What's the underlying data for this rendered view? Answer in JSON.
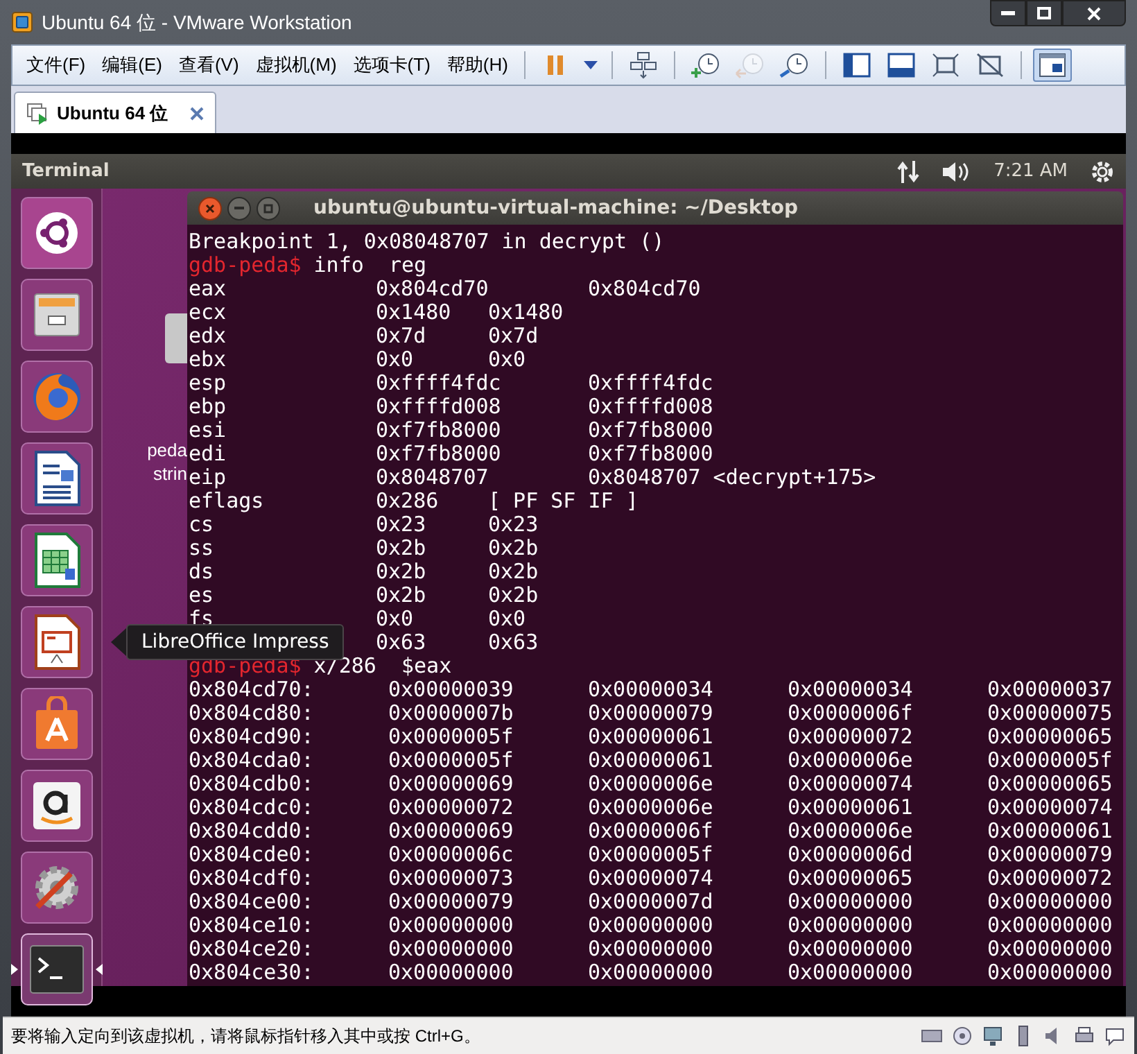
{
  "window": {
    "title": "Ubuntu 64 位 - VMware Workstation"
  },
  "menu": [
    "文件(F)",
    "编辑(E)",
    "查看(V)",
    "虚拟机(M)",
    "选项卡(T)",
    "帮助(H)"
  ],
  "toolbar": [
    {
      "buttons": [
        {
          "kind": "pause",
          "pressed": false,
          "disabled": false
        },
        {
          "kind": "dropdown",
          "pressed": false,
          "disabled": false
        }
      ]
    },
    {
      "buttons": [
        {
          "kind": "send-keys",
          "pressed": false,
          "disabled": false
        }
      ]
    },
    {
      "buttons": [
        {
          "kind": "snapshot-take",
          "pressed": false,
          "disabled": false
        },
        {
          "kind": "snapshot-revert",
          "pressed": false,
          "disabled": true
        },
        {
          "kind": "snapshot-manager",
          "pressed": false,
          "disabled": false
        }
      ]
    },
    {
      "buttons": [
        {
          "kind": "sidebar",
          "pressed": false,
          "disabled": false
        },
        {
          "kind": "thumbnail",
          "pressed": false,
          "disabled": false
        },
        {
          "kind": "fullscreen",
          "pressed": false,
          "disabled": false
        },
        {
          "kind": "no-scale",
          "pressed": false,
          "disabled": false
        }
      ]
    },
    {
      "buttons": [
        {
          "kind": "console-view",
          "pressed": true,
          "disabled": false
        }
      ]
    }
  ],
  "tabs": [
    {
      "label": "Ubuntu 64 位",
      "selected": true
    }
  ],
  "ubuntu_panel": {
    "app_name": "Terminal",
    "clock": "7:21 AM"
  },
  "launcher": [
    {
      "kind": "dash",
      "active": false
    },
    {
      "kind": "files",
      "active": false
    },
    {
      "kind": "firefox",
      "active": false
    },
    {
      "kind": "writer",
      "active": false
    },
    {
      "kind": "calc",
      "active": false
    },
    {
      "kind": "impress",
      "active": false
    },
    {
      "kind": "software",
      "active": false
    },
    {
      "kind": "amazon",
      "active": false
    },
    {
      "kind": "settings",
      "active": false
    },
    {
      "kind": "terminal",
      "active": true
    }
  ],
  "tooltip": "LibreOffice Impress",
  "desktop_icon": {
    "label_lines": [
      "peda",
      "strin"
    ]
  },
  "terminal": {
    "title": "ubuntu@ubuntu-virtual-machine: ~/Desktop",
    "lines": [
      {
        "kind": "text",
        "text": "Breakpoint 1, 0x08048707 in decrypt ()"
      },
      {
        "kind": "prompt",
        "prompt": "gdb-peda$",
        "command": "info  reg"
      },
      {
        "kind": "reg",
        "name": "eax",
        "value": "0x804cd70",
        "natural": "0x804cd70"
      },
      {
        "kind": "reg",
        "name": "ecx",
        "value": "0x1480",
        "natural": "0x1480"
      },
      {
        "kind": "reg",
        "name": "edx",
        "value": "0x7d",
        "natural": "0x7d"
      },
      {
        "kind": "reg",
        "name": "ebx",
        "value": "0x0",
        "natural": "0x0"
      },
      {
        "kind": "reg",
        "name": "esp",
        "value": "0xffff4fdc",
        "natural": "0xffff4fdc"
      },
      {
        "kind": "reg",
        "name": "ebp",
        "value": "0xffffd008",
        "natural": "0xffffd008"
      },
      {
        "kind": "reg",
        "name": "esi",
        "value": "0xf7fb8000",
        "natural": "0xf7fb8000"
      },
      {
        "kind": "reg",
        "name": "edi",
        "value": "0xf7fb8000",
        "natural": "0xf7fb8000"
      },
      {
        "kind": "reg",
        "name": "eip",
        "value": "0x8048707",
        "natural": "0x8048707 <decrypt+175>"
      },
      {
        "kind": "reg",
        "name": "eflags",
        "value": "0x286",
        "natural": "[ PF SF IF ]"
      },
      {
        "kind": "reg",
        "name": "cs",
        "value": "0x23",
        "natural": "0x23"
      },
      {
        "kind": "reg",
        "name": "ss",
        "value": "0x2b",
        "natural": "0x2b"
      },
      {
        "kind": "reg",
        "name": "ds",
        "value": "0x2b",
        "natural": "0x2b"
      },
      {
        "kind": "reg",
        "name": "es",
        "value": "0x2b",
        "natural": "0x2b"
      },
      {
        "kind": "reg",
        "name": "fs",
        "value": "0x0",
        "natural": "0x0"
      },
      {
        "kind": "reg",
        "value": "0x63",
        "natural": "0x63"
      },
      {
        "kind": "prompt",
        "prompt": "gdb-peda$",
        "command": "x/286  $eax"
      },
      {
        "kind": "mem",
        "address": "0x804cd70:",
        "values": [
          "0x00000039",
          "0x00000034",
          "0x00000034",
          "0x00000037"
        ]
      },
      {
        "kind": "mem",
        "address": "0x804cd80:",
        "values": [
          "0x0000007b",
          "0x00000079",
          "0x0000006f",
          "0x00000075"
        ]
      },
      {
        "kind": "mem",
        "address": "0x804cd90:",
        "values": [
          "0x0000005f",
          "0x00000061",
          "0x00000072",
          "0x00000065"
        ]
      },
      {
        "kind": "mem",
        "address": "0x804cda0:",
        "values": [
          "0x0000005f",
          "0x00000061",
          "0x0000006e",
          "0x0000005f"
        ]
      },
      {
        "kind": "mem",
        "address": "0x804cdb0:",
        "values": [
          "0x00000069",
          "0x0000006e",
          "0x00000074",
          "0x00000065"
        ]
      },
      {
        "kind": "mem",
        "address": "0x804cdc0:",
        "values": [
          "0x00000072",
          "0x0000006e",
          "0x00000061",
          "0x00000074"
        ]
      },
      {
        "kind": "mem",
        "address": "0x804cdd0:",
        "values": [
          "0x00000069",
          "0x0000006f",
          "0x0000006e",
          "0x00000061"
        ]
      },
      {
        "kind": "mem",
        "address": "0x804cde0:",
        "values": [
          "0x0000006c",
          "0x0000005f",
          "0x0000006d",
          "0x00000079"
        ]
      },
      {
        "kind": "mem",
        "address": "0x804cdf0:",
        "values": [
          "0x00000073",
          "0x00000074",
          "0x00000065",
          "0x00000072"
        ]
      },
      {
        "kind": "mem",
        "address": "0x804ce00:",
        "values": [
          "0x00000079",
          "0x0000007d",
          "0x00000000",
          "0x00000000"
        ]
      },
      {
        "kind": "mem",
        "address": "0x804ce10:",
        "values": [
          "0x00000000",
          "0x00000000",
          "0x00000000",
          "0x00000000"
        ]
      },
      {
        "kind": "mem",
        "address": "0x804ce20:",
        "values": [
          "0x00000000",
          "0x00000000",
          "0x00000000",
          "0x00000000"
        ]
      },
      {
        "kind": "mem",
        "address": "0x804ce30:",
        "values": [
          "0x00000000",
          "0x00000000",
          "0x00000000",
          "0x00000000"
        ]
      }
    ]
  },
  "status_bar": {
    "message": "要将输入定向到该虚拟机，请将鼠标指针移入其中或按 Ctrl+G。"
  }
}
